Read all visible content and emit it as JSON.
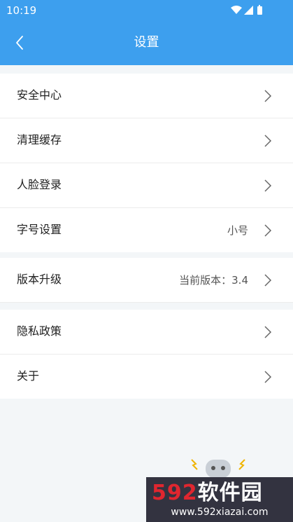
{
  "status_bar": {
    "time": "10:19",
    "icons": [
      "wifi-icon",
      "signal-icon",
      "battery-icon"
    ]
  },
  "header": {
    "title": "设置",
    "back_icon": "chevron-left-icon"
  },
  "groups": [
    {
      "items": [
        {
          "label": "安全中心",
          "value": ""
        },
        {
          "label": "清理缓存",
          "value": ""
        },
        {
          "label": "人脸登录",
          "value": ""
        },
        {
          "label": "字号设置",
          "value": "小号"
        }
      ]
    },
    {
      "items": [
        {
          "label": "版本升级",
          "value": "当前版本：3.4"
        }
      ]
    },
    {
      "items": [
        {
          "label": "隐私政策",
          "value": ""
        },
        {
          "label": "关于",
          "value": ""
        }
      ]
    }
  ],
  "watermark": {
    "brand_num": "592",
    "brand_text": "软件园",
    "url": "www.592xiazai.com"
  },
  "colors": {
    "header_bg": "#3d9fee",
    "page_bg": "#f3f6f8",
    "card_bg": "#ffffff",
    "text": "#222222",
    "secondary_text": "#555555"
  }
}
